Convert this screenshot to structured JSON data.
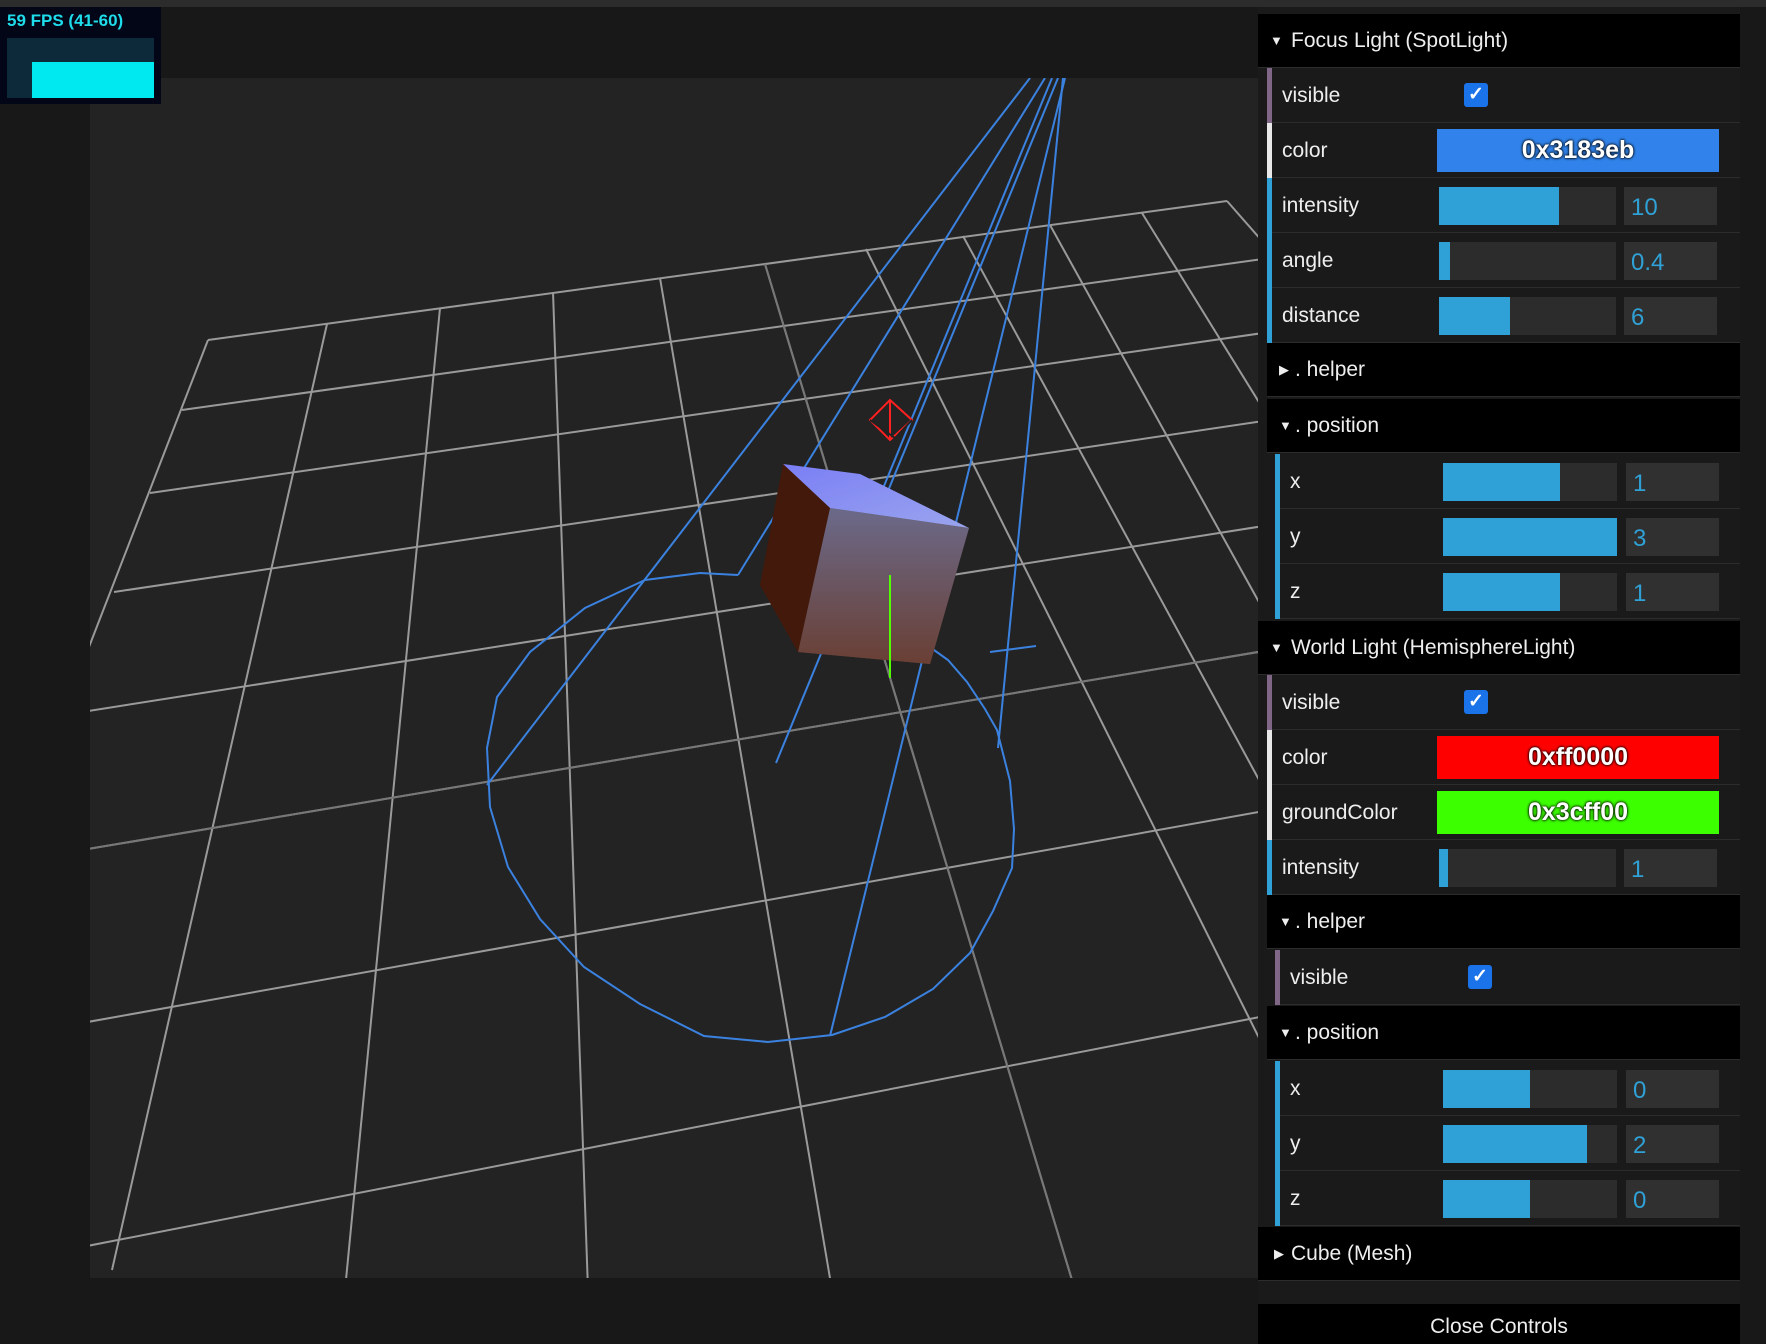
{
  "stats": {
    "fps_text": "59 FPS (41-60)"
  },
  "gui": {
    "close_label": "Close Controls",
    "spot": {
      "title": "Focus Light (SpotLight)",
      "visible_label": "visible",
      "visible": true,
      "color_label": "color",
      "color_value": "0x3183eb",
      "color_hex": "#3183eb",
      "intensity_label": "intensity",
      "intensity_value": "10",
      "intensity_fill": 0.68,
      "angle_label": "angle",
      "angle_value": "0.4",
      "angle_fill": 0.06,
      "distance_label": "distance",
      "distance_value": "6",
      "distance_fill": 0.4,
      "helper_title": ". helper",
      "position_title": ". position",
      "pos_x_label": "x",
      "pos_x_value": "1",
      "pos_x_fill": 0.67,
      "pos_y_label": "y",
      "pos_y_value": "3",
      "pos_y_fill": 1.0,
      "pos_z_label": "z",
      "pos_z_value": "1",
      "pos_z_fill": 0.67
    },
    "hemi": {
      "title": "World Light (HemisphereLight)",
      "visible_label": "visible",
      "visible": true,
      "color_label": "color",
      "color_value": "0xff0000",
      "color_hex": "#ff0000",
      "ground_label": "groundColor",
      "ground_value": "0x3cff00",
      "ground_hex": "#3cff00",
      "intensity_label": "intensity",
      "intensity_value": "1",
      "intensity_fill": 0.05,
      "helper_title": ". helper",
      "helper_visible_label": "visible",
      "helper_visible": true,
      "position_title": ". position",
      "pos_x_label": "x",
      "pos_x_value": "0",
      "pos_x_fill": 0.5,
      "pos_y_label": "y",
      "pos_y_value": "2",
      "pos_y_fill": 0.83,
      "pos_z_label": "z",
      "pos_z_value": "0",
      "pos_z_fill": 0.5
    },
    "cube": {
      "title": "Cube (Mesh)"
    }
  },
  "colors": {
    "accent_blue": "#2fa1d6",
    "grid": "#9a9a9a",
    "spot_helper": "#3b82e0"
  }
}
